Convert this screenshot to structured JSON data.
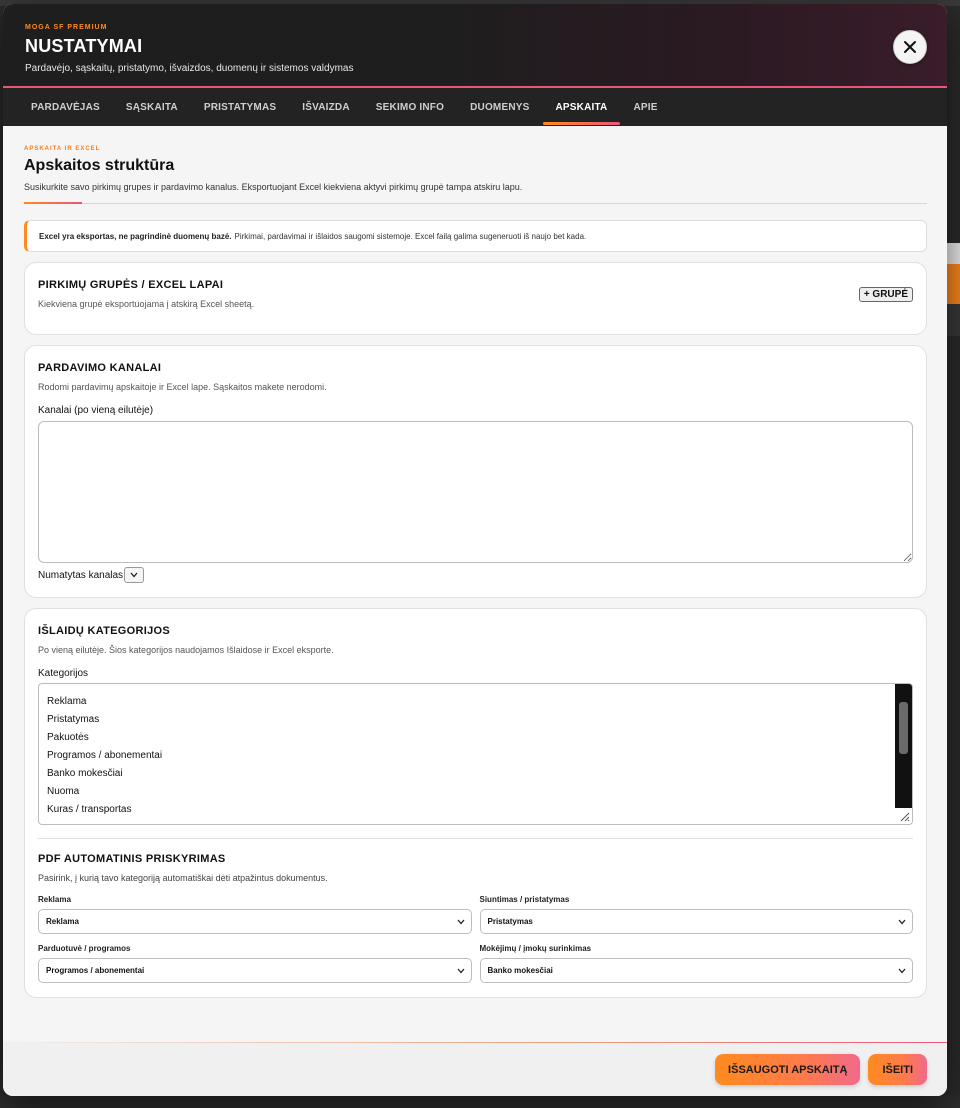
{
  "header": {
    "eyebrow": "MOGA SF PREMIUM",
    "title": "NUSTATYMAI",
    "subtitle": "Pardavėjo, sąskaitų, pristatymo, išvaizdos, duomenų ir sistemos valdymas"
  },
  "tabs": [
    {
      "label": "PARDAVĖJAS"
    },
    {
      "label": "SĄSKAITA"
    },
    {
      "label": "PRISTATYMAS"
    },
    {
      "label": "IŠVAIZDA"
    },
    {
      "label": "SEKIMO INFO"
    },
    {
      "label": "DUOMENYS"
    },
    {
      "label": "APSKAITA",
      "active": true
    },
    {
      "label": "APIE"
    }
  ],
  "section": {
    "eyebrow": "APSKAITA IR EXCEL",
    "title": "Apskaitos struktūra",
    "subtitle": "Susikurkite savo pirkimų grupes ir pardavimo kanalus. Eksportuojant Excel kiekviena aktyvi pirkimų grupė tampa atskiru lapu."
  },
  "notice": {
    "bold": "Excel yra eksportas, ne pagrindinė duomenų bazė.",
    "text": "Pirkimai, pardavimai ir išlaidos saugomi sistemoje. Excel failą galima sugeneruoti iš naujo bet kada."
  },
  "purchase_groups": {
    "title": "PIRKIMŲ GRUPĖS / EXCEL LAPAI",
    "subtitle": "Kiekviena grupė eksportuojama į atskirą Excel sheetą.",
    "add_button": "+ GRUPĖ"
  },
  "sales_channels": {
    "title": "PARDAVIMO KANALAI",
    "subtitle": "Rodomi pardavimų apskaitoje ir Excel lape. Sąskaitos makete nerodomi.",
    "field_label": "Kanalai (po vieną eilutėje)",
    "value": "",
    "default_label": "Numatytas kanalas"
  },
  "expense_categories": {
    "title": "IŠLAIDŲ KATEGORIJOS",
    "subtitle": "Po vieną eilutėje. Šios kategorijos naudojamos Išlaidose ir Excel eksporte.",
    "field_label": "Kategorijos",
    "items": [
      "Reklama",
      "Pristatymas",
      "Pakuotės",
      "Programos / abonementai",
      "Banko mokesčiai",
      "Nuoma",
      "Kuras / transportas"
    ]
  },
  "pdf_assignment": {
    "title": "PDF AUTOMATINIS PRISKYRIMAS",
    "subtitle": "Pasirink, į kurią tavo kategoriją automatiškai dėti atpažintus dokumentus.",
    "rows": [
      {
        "label": "Reklama",
        "value": "Reklama"
      },
      {
        "label": "Siuntimas / pristatymas",
        "value": "Pristatymas"
      },
      {
        "label": "Parduotuvė / programos",
        "value": "Programos / abonementai"
      },
      {
        "label": "Mokėjimų / įmokų surinkimas",
        "value": "Banko mokesčiai"
      }
    ]
  },
  "footer": {
    "save_label": "IŠSAUGOTI APSKAITĄ",
    "exit_label": "IŠEITI"
  },
  "colors": {
    "accent_orange": "#ff8a1f",
    "accent_pink": "#e8577a",
    "header_bg": "#1e1e1e"
  }
}
